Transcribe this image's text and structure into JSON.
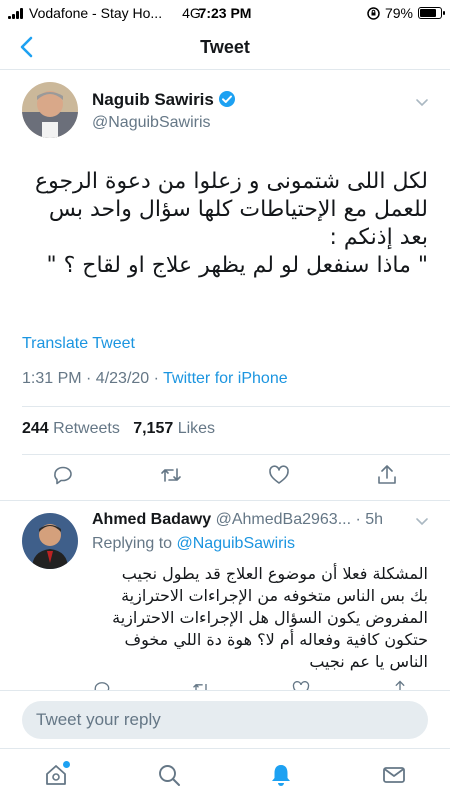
{
  "status_bar": {
    "carrier": "Vodafone - Stay Ho...",
    "network": "4G",
    "time": "7:23 PM",
    "battery": "79%",
    "battery_level": 0.79
  },
  "nav": {
    "title": "Tweet"
  },
  "tweet": {
    "author_name": "Naguib Sawiris",
    "handle": "@NaguibSawiris",
    "text_lines": [
      "لكل اللى شتمونى و زعلوا من دعوة الرجوع",
      "للعمل مع الإحتياطات كلها سؤال واحد بس",
      "بعد إذنكم :",
      "\" ماذا سنفعل لو لم يظهر علاج او لقاح ؟ \""
    ],
    "translate": "Translate Tweet",
    "timestamp": "1:31 PM · 4/23/20 ·",
    "source": "Twitter for iPhone",
    "retweets_count": "244",
    "retweets_label": "Retweets",
    "likes_count": "7,157",
    "likes_label": "Likes"
  },
  "reply": {
    "name": "Ahmed Badawy",
    "handle": "@AhmedBa2963...",
    "time": "· 5h",
    "replying_prefix": "Replying to",
    "replying_to": "@NaguibSawiris",
    "text_lines": [
      "المشكلة فعلا أن موضوع العلاج قد يطول نجيب",
      "بك بس الناس متخوفه من الإجراءات الاحترازية",
      "المفروض يكون السؤال هل الإجراءات الاحترازية",
      "حتكون كافية وفعاله أم لا؟ هوة دة اللي مخوف",
      "الناس يا عم نجيب"
    ]
  },
  "compose": {
    "placeholder": "Tweet your reply"
  },
  "colors": {
    "accent": "#1da1f2",
    "link": "#1b95e0",
    "muted": "#657786"
  },
  "icons": {
    "tweet_actions": [
      "reply-icon",
      "retweet-icon",
      "like-icon",
      "share-icon"
    ],
    "tabs": [
      "home-icon",
      "search-icon",
      "notifications-icon",
      "messages-icon"
    ]
  }
}
